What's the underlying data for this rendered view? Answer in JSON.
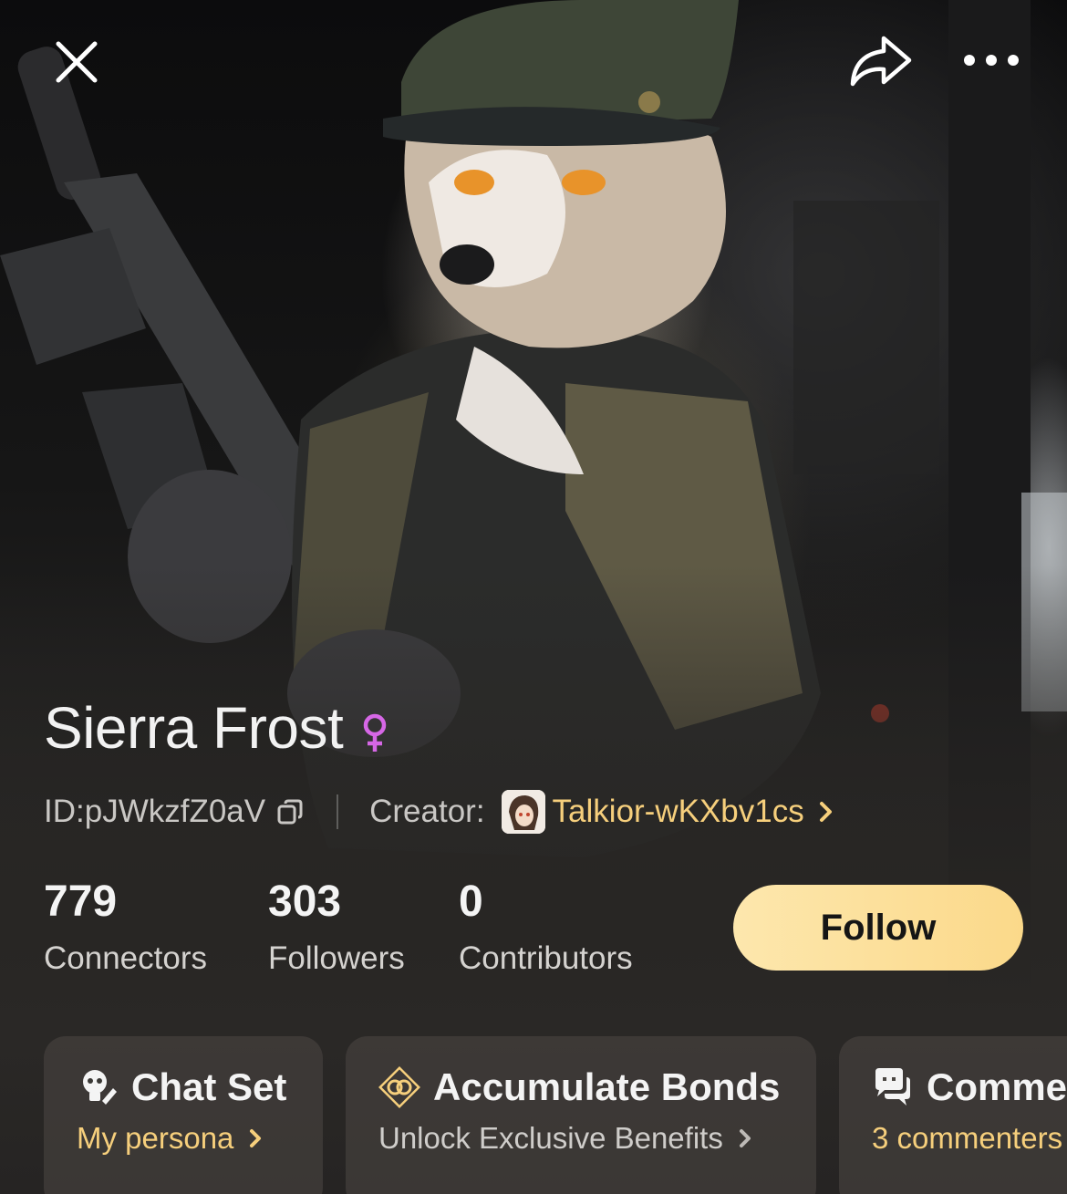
{
  "character": {
    "name": "Sierra Frost",
    "gender_icon": "female-icon",
    "id_label": "ID:pJWkzfZ0aV",
    "creator_label": "Creator:",
    "creator_name": "Talkior-wKXbv1cs"
  },
  "stats": [
    {
      "value": "779",
      "label": "Connectors"
    },
    {
      "value": "303",
      "label": "Followers"
    },
    {
      "value": "0",
      "label": "Contributors"
    }
  ],
  "actions": {
    "follow_label": "Follow"
  },
  "cards": {
    "chat_set": {
      "title": "Chat Set",
      "subtitle": "My persona",
      "icon": "persona-icon"
    },
    "bonds": {
      "title": "Accumulate Bonds",
      "subtitle": "Unlock Exclusive Benefits",
      "icon": "rings-icon"
    },
    "comments": {
      "title": "Comme",
      "subtitle": "3 commenters",
      "icon": "chat-bubbles-icon"
    }
  },
  "colors": {
    "accent_gold": "#f6cf7c",
    "follow_button": "#fbd98a",
    "gender_female": "#d667e6",
    "background": "#1c1b1a"
  },
  "icons": [
    "close-icon",
    "share-icon",
    "more-icon",
    "copy-icon",
    "chevron-right-icon"
  ]
}
